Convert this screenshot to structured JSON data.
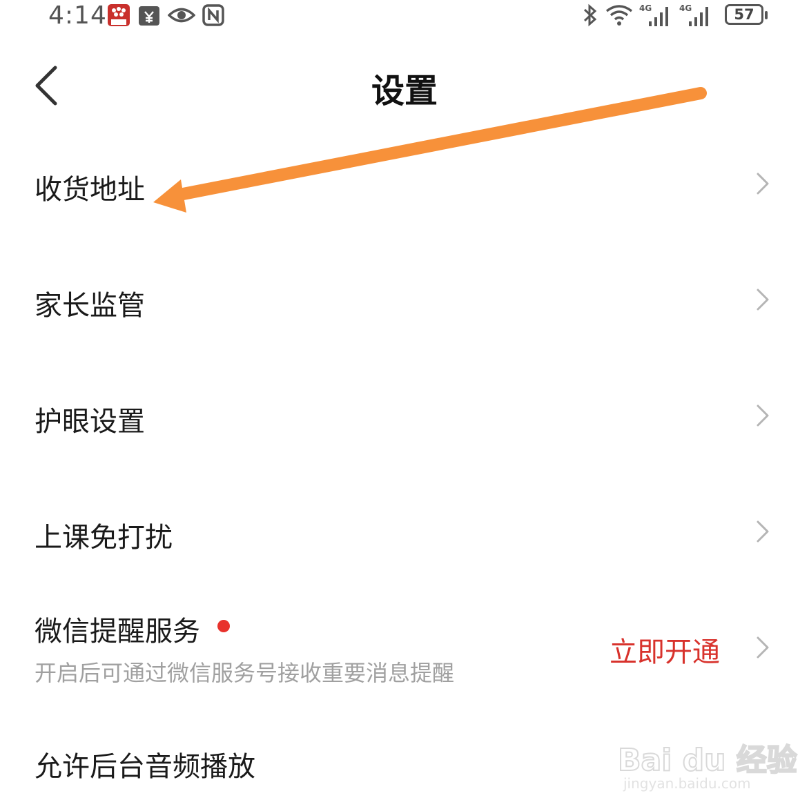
{
  "status_bar": {
    "time": "4:14",
    "battery": "57",
    "network_left": "4G",
    "network_right": "4G"
  },
  "header": {
    "title": "设置"
  },
  "settings": {
    "items": [
      {
        "label": "收货地址"
      },
      {
        "label": "家长监管"
      },
      {
        "label": "护眼设置"
      },
      {
        "label": "上课免打扰"
      },
      {
        "label": "微信提醒服务",
        "subtitle": "开启后可通过微信服务号接收重要消息提醒",
        "action": "立即开通"
      },
      {
        "label": "允许后台音频播放"
      }
    ]
  },
  "watermark": {
    "logo": "Bai du 经验",
    "url": "jingyan.baidu.com"
  },
  "colors": {
    "accent_red": "#d8322c",
    "arrow_orange": "#f7913a",
    "chevron": "#b5b5b5"
  }
}
